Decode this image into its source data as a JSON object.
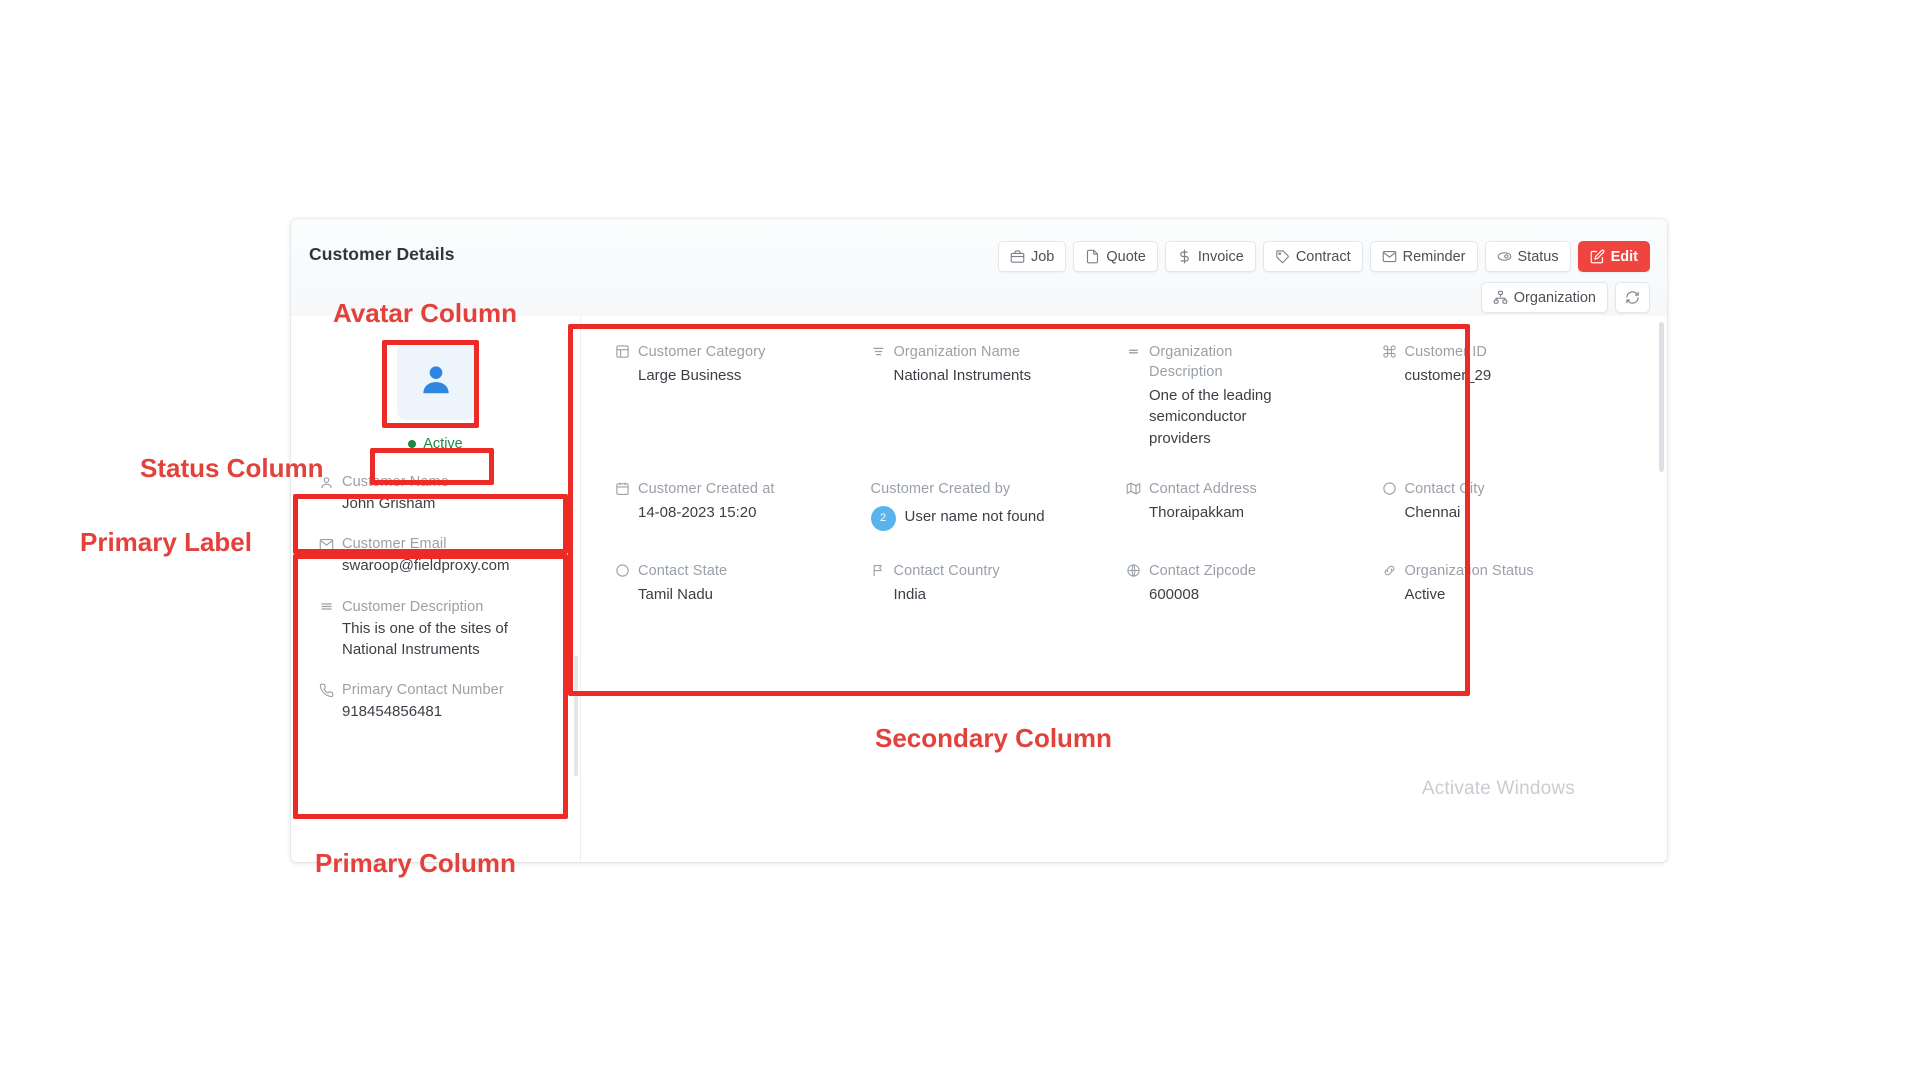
{
  "page": {
    "title": "Customer Details",
    "watermark": "Activate Windows",
    "accent_red": "#ec2b26",
    "status_green": "#1a8a45",
    "avatar_blue": "#2f86e0"
  },
  "toolbar": {
    "row1": [
      {
        "label": "Job",
        "icon": "briefcase-icon",
        "variant": "default"
      },
      {
        "label": "Quote",
        "icon": "document-icon",
        "variant": "default"
      },
      {
        "label": "Invoice",
        "icon": "dollar-icon",
        "variant": "default"
      },
      {
        "label": "Contract",
        "icon": "tag-icon",
        "variant": "default"
      },
      {
        "label": "Reminder",
        "icon": "mail-icon",
        "variant": "default"
      },
      {
        "label": "Status",
        "icon": "toggle-icon",
        "variant": "default"
      },
      {
        "label": "Edit",
        "icon": "edit-icon",
        "variant": "danger"
      }
    ],
    "row2": [
      {
        "label": "Organization",
        "icon": "org-chart-icon",
        "variant": "default"
      },
      {
        "label": "",
        "icon": "refresh-icon",
        "variant": "icon-only"
      }
    ]
  },
  "primary_column": {
    "avatar": {
      "icon": "person-icon"
    },
    "status": {
      "label": "Active",
      "dot_color": "#1a8a45"
    },
    "fields": [
      {
        "icon": "person-icon",
        "label": "Customer Name",
        "value": "John Grisham"
      },
      {
        "icon": "mail-icon",
        "label": "Customer Email",
        "value": "swaroop@fieldproxy.com"
      },
      {
        "icon": "lines-icon",
        "label": "Customer Description",
        "value": "This is one of the sites of National Instruments"
      },
      {
        "icon": "phone-icon",
        "label": "Primary Contact Number",
        "value": "918454856481"
      }
    ]
  },
  "secondary_column": {
    "fields": [
      {
        "icon": "layout-icon",
        "label": "Customer Category",
        "value": "Large Business"
      },
      {
        "icon": "align-icon",
        "label": "Organization Name",
        "value": "National Instruments"
      },
      {
        "icon": "lines-icon",
        "label": "Organization Description",
        "value": "One of the leading semiconductor providers"
      },
      {
        "icon": "command-icon",
        "label": "Customer ID",
        "value": "customer_29"
      },
      {
        "icon": "calendar-icon",
        "label": "Customer Created at",
        "value": "14-08-2023 15:20"
      },
      {
        "icon": "none",
        "label": "Customer Created by",
        "value": "User name not found",
        "badge": "2"
      },
      {
        "icon": "map-icon",
        "label": "Contact Address",
        "value": "Thoraipakkam"
      },
      {
        "icon": "circle-icon",
        "label": "Contact City",
        "value": "Chennai"
      },
      {
        "icon": "circle-icon",
        "label": "Contact State",
        "value": "Tamil Nadu"
      },
      {
        "icon": "flag-icon",
        "label": "Contact Country",
        "value": "India"
      },
      {
        "icon": "globe-icon",
        "label": "Contact Zipcode",
        "value": "600008"
      },
      {
        "icon": "link-icon",
        "label": "Organization Status",
        "value": "Active"
      }
    ]
  },
  "annotations": [
    {
      "text": "Avatar Column"
    },
    {
      "text": "Status Column"
    },
    {
      "text": "Primary Label"
    },
    {
      "text": "Primary Column"
    },
    {
      "text": "Secondary Column"
    }
  ]
}
